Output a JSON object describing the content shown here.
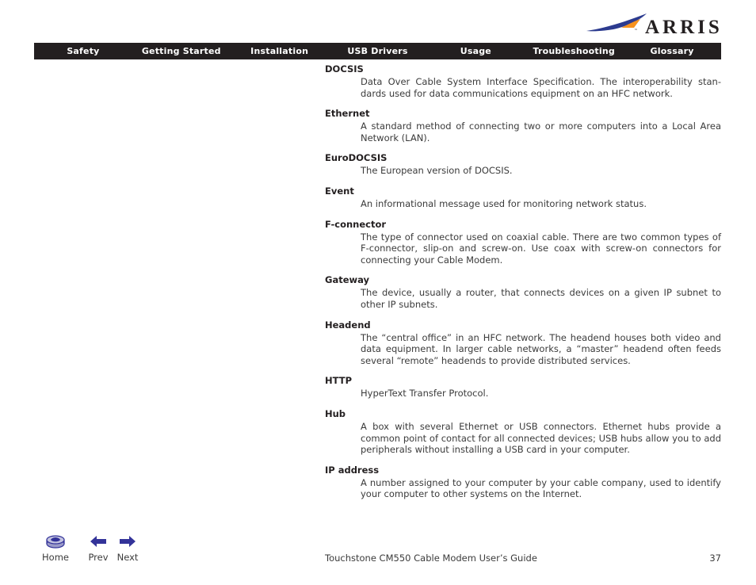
{
  "brand": {
    "logo_text": "ARRIS",
    "trademark_mark": "™",
    "swoosh_blue": "#2c3b8f",
    "swoosh_orange": "#f6921e",
    "wordmark_color": "#231f20"
  },
  "navbar": {
    "background": "#231f20",
    "text_color": "#ffffff",
    "items": [
      {
        "label": "Safety"
      },
      {
        "label": "Getting Started"
      },
      {
        "label": "Installation"
      },
      {
        "label": "USB Drivers"
      },
      {
        "label": "Usage"
      },
      {
        "label": "Troubleshooting"
      },
      {
        "label": "Glossary"
      }
    ]
  },
  "glossary": {
    "entries": [
      {
        "term": "DOCSIS",
        "definition": "Data Over Cable System Interface Specification. The interoperability stan­dards used for data communications equipment on an HFC network."
      },
      {
        "term": "Ethernet",
        "definition": "A standard method of connecting two or more computers into a Local Area Network (LAN)."
      },
      {
        "term": "EuroDOCSIS",
        "definition": "The European version of DOCSIS."
      },
      {
        "term": "Event",
        "definition": "An informational message used for monitoring network status."
      },
      {
        "term": "F-connector",
        "definition": "The type of connector used on coaxial cable. There are two common types of F-connector, slip-on and screw-on. Use coax with screw-on connectors for connecting your Cable Modem."
      },
      {
        "term": "Gateway",
        "definition": "The device, usually a router, that connects devices on a given IP subnet to other IP subnets."
      },
      {
        "term": "Headend",
        "definition": "The “central office” in an HFC network. The headend houses both video and data equipment. In larger cable networks, a “master” headend often feeds several “remote” headends to provide distributed services."
      },
      {
        "term": "HTTP",
        "definition": "HyperText Transfer Protocol."
      },
      {
        "term": "Hub",
        "definition": "A box with several Ethernet or USB connectors. Ethernet hubs provide a common point of contact for all connected devices; USB hubs allow you to add peripherals without installing a USB card in your computer."
      },
      {
        "term": "IP address",
        "definition": "A number assigned to your computer by your cable company, used to iden­tify your computer to other systems on the Internet."
      }
    ]
  },
  "footer": {
    "home_label": "Home",
    "prev_label": "Prev",
    "next_label": "Next",
    "document_title": "Touchstone CM550 Cable Modem User’s Guide",
    "page_number": "37",
    "nav_icon_color": "#333399"
  }
}
